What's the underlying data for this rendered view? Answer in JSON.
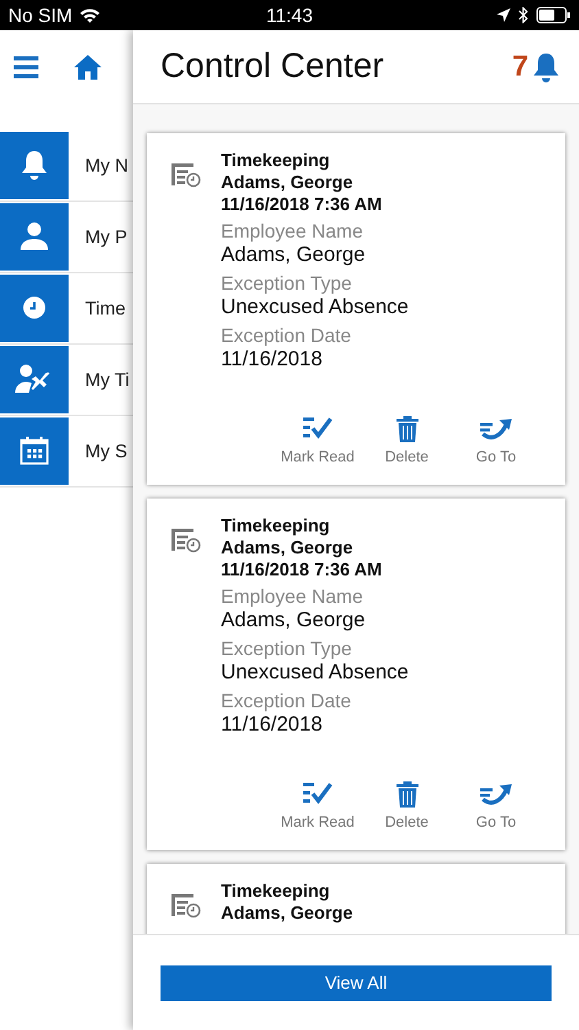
{
  "status_bar": {
    "carrier": "No SIM",
    "time": "11:43"
  },
  "nav": {
    "items": [
      {
        "kind": "bell",
        "label": "My N"
      },
      {
        "kind": "person",
        "label": "My P"
      },
      {
        "kind": "clock",
        "label": "Time"
      },
      {
        "kind": "travel",
        "label": "My Ti"
      },
      {
        "kind": "calendar",
        "label": "My S"
      }
    ]
  },
  "panel": {
    "title": "Control Center",
    "badge": "7",
    "cards": [
      {
        "category": "Timekeeping",
        "employee": "Adams, George",
        "timestamp": "11/16/2018 7:36 AM",
        "fields": [
          {
            "label": "Employee Name",
            "value": "Adams, George"
          },
          {
            "label": "Exception Type",
            "value": "Unexcused Absence"
          },
          {
            "label": "Exception Date",
            "value": "11/16/2018"
          }
        ],
        "actions": [
          {
            "kind": "mark-read",
            "label": "Mark Read"
          },
          {
            "kind": "delete",
            "label": "Delete"
          },
          {
            "kind": "go-to",
            "label": "Go To"
          }
        ]
      },
      {
        "category": "Timekeeping",
        "employee": "Adams, George",
        "timestamp": "11/16/2018 7:36 AM",
        "fields": [
          {
            "label": "Employee Name",
            "value": "Adams, George"
          },
          {
            "label": "Exception Type",
            "value": "Unexcused Absence"
          },
          {
            "label": "Exception Date",
            "value": "11/16/2018"
          }
        ],
        "actions": [
          {
            "kind": "mark-read",
            "label": "Mark Read"
          },
          {
            "kind": "delete",
            "label": "Delete"
          },
          {
            "kind": "go-to",
            "label": "Go To"
          }
        ]
      },
      {
        "category": "Timekeeping",
        "employee": "Adams, George"
      }
    ],
    "view_all": "View All"
  }
}
